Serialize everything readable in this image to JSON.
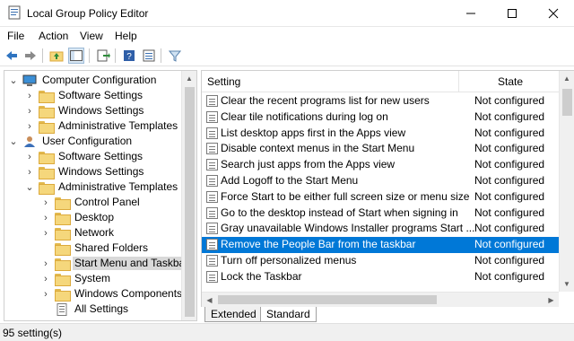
{
  "window": {
    "title": "Local Group Policy Editor"
  },
  "menu": [
    "File",
    "Action",
    "View",
    "Help"
  ],
  "tree": {
    "items": [
      {
        "label": "Computer Configuration",
        "type": "computer",
        "level": 0,
        "expanded": true
      },
      {
        "label": "Software Settings",
        "type": "folder",
        "level": 1,
        "expanded": false
      },
      {
        "label": "Windows Settings",
        "type": "folder",
        "level": 1,
        "expanded": false
      },
      {
        "label": "Administrative Templates",
        "type": "folder",
        "level": 1,
        "expanded": false
      },
      {
        "label": "User Configuration",
        "type": "user",
        "level": 0,
        "expanded": true
      },
      {
        "label": "Software Settings",
        "type": "folder",
        "level": 1,
        "expanded": false
      },
      {
        "label": "Windows Settings",
        "type": "folder",
        "level": 1,
        "expanded": false
      },
      {
        "label": "Administrative Templates",
        "type": "folder",
        "level": 1,
        "expanded": true
      },
      {
        "label": "Control Panel",
        "type": "folder",
        "level": 2,
        "expanded": false
      },
      {
        "label": "Desktop",
        "type": "folder",
        "level": 2,
        "expanded": false
      },
      {
        "label": "Network",
        "type": "folder",
        "level": 2,
        "expanded": false
      },
      {
        "label": "Shared Folders",
        "type": "folder",
        "level": 2,
        "expandable": false
      },
      {
        "label": "Start Menu and Taskbar",
        "type": "folder",
        "level": 2,
        "expanded": false,
        "selected": true
      },
      {
        "label": "System",
        "type": "folder",
        "level": 2,
        "expanded": false
      },
      {
        "label": "Windows Components",
        "type": "folder",
        "level": 2,
        "expanded": false
      },
      {
        "label": "All Settings",
        "type": "allsettings",
        "level": 2,
        "expandable": false
      }
    ]
  },
  "list": {
    "columns": {
      "setting": "Setting",
      "state": "State"
    },
    "rows": [
      {
        "setting": "Clear the recent programs list for new users",
        "state": "Not configured"
      },
      {
        "setting": "Clear tile notifications during log on",
        "state": "Not configured"
      },
      {
        "setting": "List desktop apps first in the Apps view",
        "state": "Not configured"
      },
      {
        "setting": "Disable context menus in the Start Menu",
        "state": "Not configured"
      },
      {
        "setting": "Search just apps from the Apps view",
        "state": "Not configured"
      },
      {
        "setting": "Add Logoff to the Start Menu",
        "state": "Not configured"
      },
      {
        "setting": "Force Start to be either full screen size or menu size",
        "state": "Not configured"
      },
      {
        "setting": "Go to the desktop instead of Start when signing in",
        "state": "Not configured"
      },
      {
        "setting": "Gray unavailable Windows Installer programs Start ...",
        "state": "Not configured"
      },
      {
        "setting": "Remove the People Bar from the taskbar",
        "state": "Not configured",
        "selected": true
      },
      {
        "setting": "Turn off personalized menus",
        "state": "Not configured"
      },
      {
        "setting": "Lock the Taskbar",
        "state": "Not configured"
      }
    ]
  },
  "tabs": [
    {
      "label": "Extended",
      "active": false
    },
    {
      "label": "Standard",
      "active": true
    }
  ],
  "status": {
    "text": "95 setting(s)"
  },
  "colors": {
    "selection": "#0078d7",
    "tree_selection": "#d9d9d9"
  }
}
